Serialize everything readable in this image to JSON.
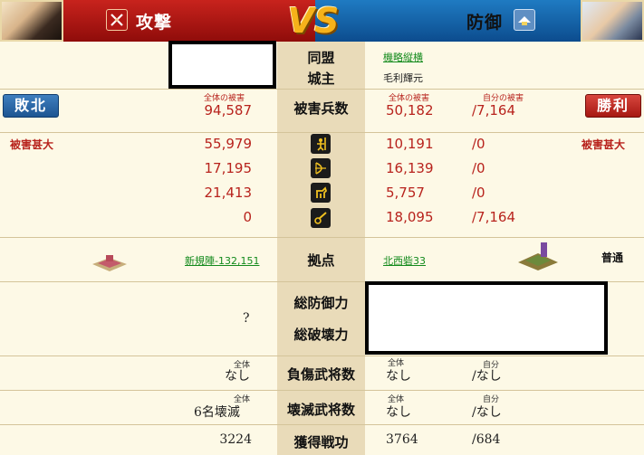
{
  "header": {
    "attack_label": "攻撃",
    "defense_label": "防御",
    "vs_label": "VS"
  },
  "alliance": {
    "label": "同盟",
    "defender_value": "機略縦横"
  },
  "lord": {
    "label": "城主",
    "defender_value": "毛利輝元"
  },
  "damage": {
    "label": "被害兵数",
    "attacker_total_caption": "全体の被害",
    "attacker_total": "94,587",
    "defender_total_caption": "全体の被害",
    "defender_total": "50,182",
    "defender_self_caption": "自分の被害",
    "defender_self": "/7,164"
  },
  "result": {
    "attacker_badge": "敗北",
    "defender_badge": "勝利"
  },
  "severity": {
    "attacker": "被害甚大",
    "defender": "被害甚大"
  },
  "units": [
    {
      "icon": "spear-soldier-icon",
      "attacker": "55,979",
      "defender": "10,191",
      "self": "/0"
    },
    {
      "icon": "bow-icon",
      "attacker": "17,195",
      "defender": "16,139",
      "self": "/0"
    },
    {
      "icon": "horse-icon",
      "attacker": "21,413",
      "defender": "5,757",
      "self": "/0"
    },
    {
      "icon": "siege-weapon-icon",
      "attacker": "0",
      "defender": "18,095",
      "self": "/7,164"
    }
  ],
  "base": {
    "label": "拠点",
    "attacker_link": "新規陣-132,151",
    "defender_link": "北西砦33",
    "defender_status": "普通"
  },
  "defense": {
    "total_defense_label": "総防御力",
    "total_destruction_label": "総破壊力",
    "attacker_value": "?"
  },
  "injured": {
    "label": "負傷武将数",
    "total_caption": "全体",
    "self_caption": "自分",
    "attacker": "なし",
    "defender": "なし",
    "defender_self": "/なし"
  },
  "destroyed": {
    "label": "壊滅武将数",
    "total_caption": "全体",
    "self_caption": "自分",
    "attacker": "6名壊滅",
    "defender": "なし",
    "defender_self": "/なし"
  },
  "merit": {
    "label": "獲得戦功",
    "attacker": "3224",
    "defender": "3764",
    "defender_self": "/684"
  },
  "colors": {
    "attack_red": "#c8231d",
    "defense_blue": "#1f7bc2",
    "damage_red": "#b8231d",
    "link_green": "#138a1c",
    "center_bg": "#e9dbb9",
    "page_bg": "#fdf9e6"
  }
}
